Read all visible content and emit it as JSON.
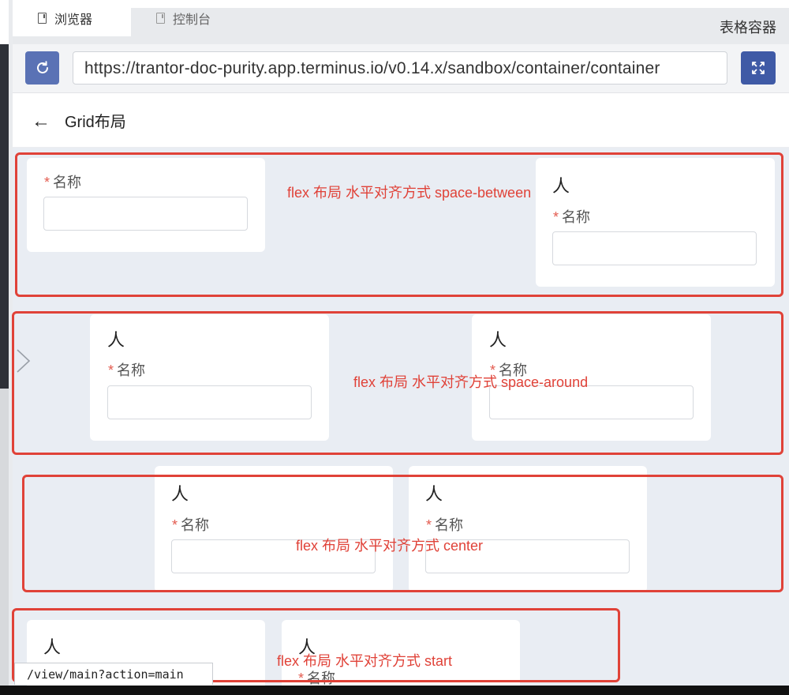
{
  "tabs": [
    {
      "label": "浏览器",
      "icon": "document-icon",
      "active": true
    },
    {
      "label": "控制台",
      "icon": "document-icon",
      "active": false
    }
  ],
  "panel_title": "表格容器",
  "url": "https://trantor-doc-purity.app.terminus.io/v0.14.x/sandbox/container/container",
  "page": {
    "back_icon": "←",
    "title": "Grid布局"
  },
  "field": {
    "required_mark": "*",
    "label": "名称",
    "person": "人"
  },
  "annotations": {
    "space_between": "flex 布局  水平对齐方式 space-between",
    "space_around": "flex 布局  水平对齐方式 space-around",
    "center": "flex 布局  水平对齐方式 center",
    "start": "flex 布局  水平对齐方式 start"
  },
  "status_url": "/view/main?action=main",
  "colors": {
    "accent": "#5a72b5",
    "accent_dark": "#3f5aa6",
    "annotation": "#e04238",
    "required": "#e35b4f",
    "content_bg": "#e9edf3"
  }
}
